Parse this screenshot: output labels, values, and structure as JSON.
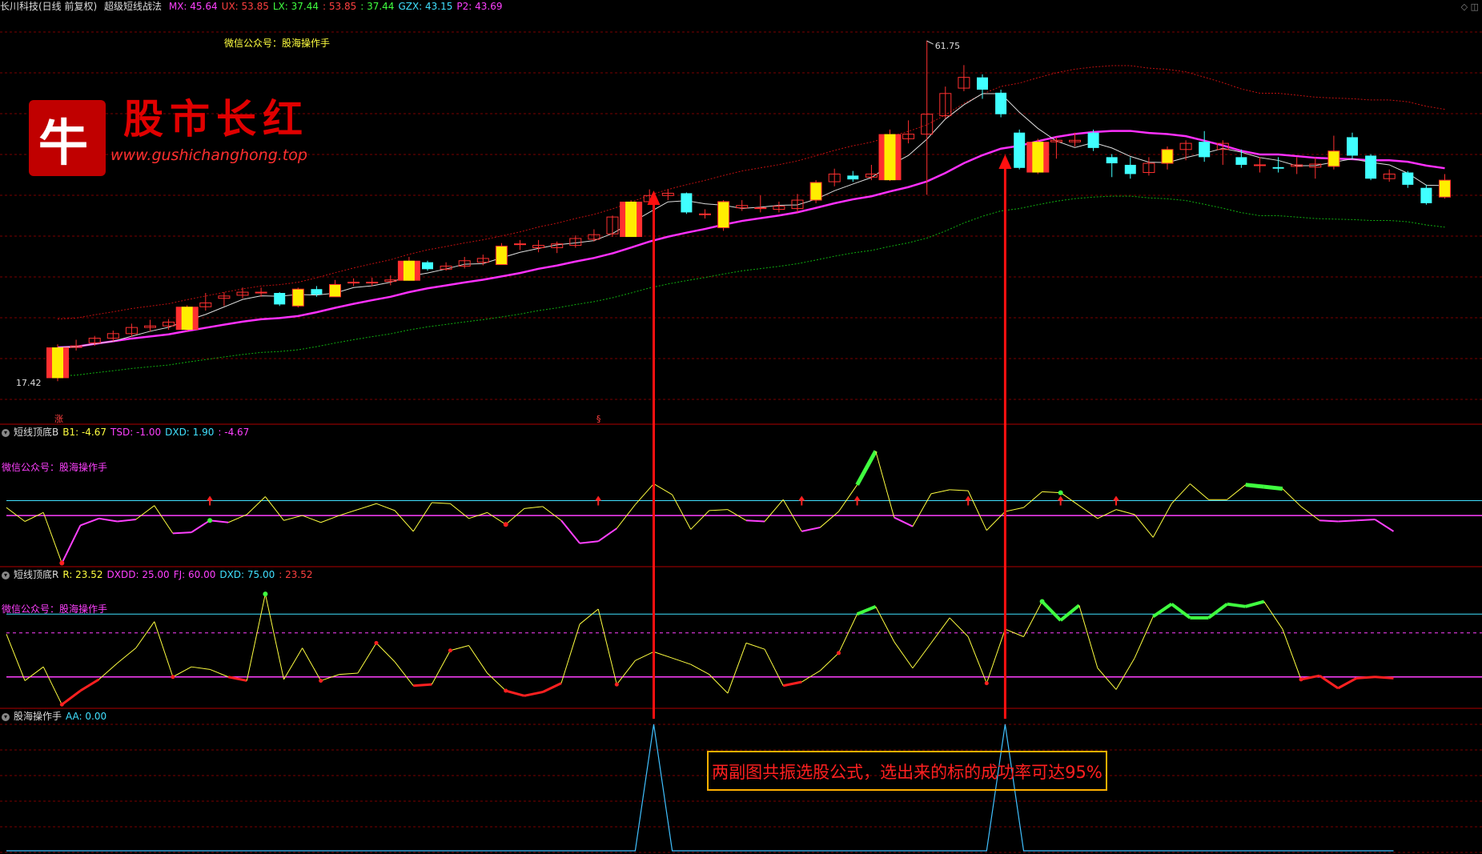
{
  "header": {
    "stock_title": "长川科技(日线 前复权)",
    "indicator_name": "超级短线战法",
    "values": [
      {
        "text": "MX: 45.64",
        "color": "#ff40ff"
      },
      {
        "text": "UX: 53.85",
        "color": "#ff4040"
      },
      {
        "text": "LX: 37.44",
        "color": "#40ff40"
      },
      {
        "text": ": 53.85",
        "color": "#ff4040"
      },
      {
        "text": ": 37.44",
        "color": "#40ff40"
      },
      {
        "text": "GZX: 43.15",
        "color": "#40e0ff"
      },
      {
        "text": "P2: 43.69",
        "color": "#ff40ff"
      }
    ],
    "wechat": "微信公众号：股海操作手"
  },
  "logo": {
    "char": "牛",
    "name": "股市长红",
    "url": "www.gushichanghong.top"
  },
  "top_right_icons": "◇ ◫",
  "main_chart": {
    "high_label": "61.75",
    "low_label": "17.42",
    "up_marker": "涨",
    "s_marker": "§"
  },
  "panel1": {
    "title": "短线顶底B",
    "values": [
      {
        "text": "B1: -4.67",
        "color": "#ffff40"
      },
      {
        "text": "TSD: -1.00",
        "color": "#ff40ff"
      },
      {
        "text": "DXD: 1.90",
        "color": "#40e0ff"
      },
      {
        "text": ": -4.67",
        "color": "#ff40ff"
      }
    ],
    "wechat": "微信公众号：股海操作手"
  },
  "panel2": {
    "title": "短线顶底R",
    "values": [
      {
        "text": "R: 23.52",
        "color": "#ffff40"
      },
      {
        "text": "DXDD: 25.00",
        "color": "#ff40ff"
      },
      {
        "text": "FJ: 60.00",
        "color": "#ff40ff"
      },
      {
        "text": "DXD: 75.00",
        "color": "#40e0ff"
      },
      {
        "text": ": 23.52",
        "color": "#ff4040"
      }
    ],
    "wechat": "微信公众号：股海操作手"
  },
  "panel3": {
    "title": "股海操作手",
    "values": [
      {
        "text": "AA: 0.00",
        "color": "#40e0ff"
      }
    ]
  },
  "annotation": "两副图共振选股公式，选出来的标的成功率可达95%",
  "colors": {
    "up": "#ff3030",
    "down": "#40ffff",
    "big_up_fill": "#ffee00",
    "ma_white": "#dddddd",
    "ma_magenta": "#ff30ff",
    "band_red": "#c01010",
    "band_green": "#10b010",
    "grid": "#7a0000",
    "arrow": "#ff1010"
  },
  "chart_data": [
    {
      "type": "candlestick",
      "title": "超级短线战法",
      "count": 76,
      "candles": [
        {
          "o": 17.8,
          "c": 21.8,
          "h": 22.2,
          "l": 17.4,
          "big": true
        },
        {
          "o": 21.8,
          "c": 22.0,
          "h": 22.8,
          "l": 21.4
        },
        {
          "o": 22.4,
          "c": 23.0,
          "h": 23.3,
          "l": 22.0
        },
        {
          "o": 23.0,
          "c": 23.6,
          "h": 24.0,
          "l": 22.6
        },
        {
          "o": 23.6,
          "c": 24.4,
          "h": 24.9,
          "l": 23.2
        },
        {
          "o": 24.4,
          "c": 24.6,
          "h": 25.4,
          "l": 23.9
        },
        {
          "o": 24.6,
          "c": 25.1,
          "h": 25.5,
          "l": 24.1
        },
        {
          "o": 24.1,
          "c": 27.1,
          "h": 27.3,
          "l": 23.9,
          "big": true
        },
        {
          "o": 27.1,
          "c": 27.6,
          "h": 28.9,
          "l": 26.6
        },
        {
          "o": 28.2,
          "c": 28.5,
          "h": 29.0,
          "l": 27.2
        },
        {
          "o": 28.6,
          "c": 29.0,
          "h": 29.6,
          "l": 28.2
        },
        {
          "o": 28.9,
          "c": 29.0,
          "h": 29.6,
          "l": 28.4
        },
        {
          "o": 28.9,
          "c": 27.4,
          "h": 29.0,
          "l": 27.2,
          "bear": true
        },
        {
          "o": 27.2,
          "c": 29.4,
          "h": 29.6,
          "l": 27.0,
          "fill": true
        },
        {
          "o": 29.4,
          "c": 28.7,
          "h": 29.8,
          "l": 28.4,
          "bear": true
        },
        {
          "o": 28.4,
          "c": 30.0,
          "h": 30.6,
          "l": 28.4,
          "fill": true
        },
        {
          "o": 30.2,
          "c": 30.3,
          "h": 30.8,
          "l": 29.8
        },
        {
          "o": 30.2,
          "c": 30.3,
          "h": 30.9,
          "l": 29.8
        },
        {
          "o": 30.4,
          "c": 30.6,
          "h": 31.2,
          "l": 29.9
        },
        {
          "o": 30.5,
          "c": 33.1,
          "h": 33.6,
          "l": 30.5,
          "big": true
        },
        {
          "o": 32.9,
          "c": 32.0,
          "h": 33.1,
          "l": 31.8,
          "bear": true
        },
        {
          "o": 32.0,
          "c": 32.4,
          "h": 32.9,
          "l": 31.8
        },
        {
          "o": 32.4,
          "c": 33.1,
          "h": 33.6,
          "l": 32.1
        },
        {
          "o": 32.9,
          "c": 33.4,
          "h": 33.9,
          "l": 32.5
        },
        {
          "o": 32.6,
          "c": 35.0,
          "h": 35.4,
          "l": 32.6,
          "fill": true
        },
        {
          "o": 35.2,
          "c": 35.3,
          "h": 35.8,
          "l": 34.5
        },
        {
          "o": 34.8,
          "c": 35.1,
          "h": 35.8,
          "l": 34.2
        },
        {
          "o": 34.8,
          "c": 35.3,
          "h": 35.6,
          "l": 34.1
        },
        {
          "o": 35.1,
          "c": 36.0,
          "h": 36.4,
          "l": 34.8
        },
        {
          "o": 35.9,
          "c": 36.5,
          "h": 37.2,
          "l": 35.6
        },
        {
          "o": 36.6,
          "c": 38.8,
          "h": 39.0,
          "l": 36.2
        },
        {
          "o": 36.2,
          "c": 40.8,
          "h": 41.0,
          "l": 36.2,
          "big": true
        },
        {
          "o": 40.8,
          "c": 41.6,
          "h": 42.4,
          "l": 40.4
        },
        {
          "o": 41.6,
          "c": 41.9,
          "h": 42.4,
          "l": 41.0
        },
        {
          "o": 41.9,
          "c": 39.4,
          "h": 42.0,
          "l": 39.2,
          "bear": true
        },
        {
          "o": 39.2,
          "c": 39.2,
          "h": 39.8,
          "l": 38.6
        },
        {
          "o": 37.4,
          "c": 40.8,
          "h": 41.0,
          "l": 37.0,
          "fill": true
        },
        {
          "o": 40.0,
          "c": 40.3,
          "h": 41.0,
          "l": 39.6
        },
        {
          "o": 39.9,
          "c": 40.0,
          "h": 41.6,
          "l": 39.4
        },
        {
          "o": 39.8,
          "c": 40.2,
          "h": 40.8,
          "l": 39.4
        },
        {
          "o": 39.9,
          "c": 41.0,
          "h": 41.8,
          "l": 39.4
        },
        {
          "o": 41.0,
          "c": 43.3,
          "h": 43.6,
          "l": 40.6,
          "fill": true
        },
        {
          "o": 43.4,
          "c": 44.4,
          "h": 45.1,
          "l": 42.8
        },
        {
          "o": 44.2,
          "c": 43.7,
          "h": 44.8,
          "l": 43.4,
          "bear": true
        },
        {
          "o": 44.0,
          "c": 44.4,
          "h": 45.6,
          "l": 43.6
        },
        {
          "o": 43.6,
          "c": 49.6,
          "h": 50.2,
          "l": 43.5,
          "big": true
        },
        {
          "o": 49.0,
          "c": 49.6,
          "h": 51.4,
          "l": 48.4
        },
        {
          "o": 49.6,
          "c": 52.2,
          "h": 61.8,
          "l": 41.7
        },
        {
          "o": 52.0,
          "c": 54.9,
          "h": 55.8,
          "l": 51.6
        },
        {
          "o": 55.6,
          "c": 57.0,
          "h": 58.6,
          "l": 55.2
        },
        {
          "o": 57.0,
          "c": 55.4,
          "h": 57.4,
          "l": 54.2,
          "bear": true
        },
        {
          "o": 55.0,
          "c": 52.2,
          "h": 55.4,
          "l": 51.8,
          "bear": true
        },
        {
          "o": 49.8,
          "c": 45.2,
          "h": 50.2,
          "l": 45.0,
          "bear": true
        },
        {
          "o": 44.6,
          "c": 48.6,
          "h": 49.0,
          "l": 44.4,
          "big": true
        },
        {
          "o": 48.6,
          "c": 48.8,
          "h": 49.2,
          "l": 46.4
        },
        {
          "o": 48.6,
          "c": 48.8,
          "h": 49.8,
          "l": 48.0
        },
        {
          "o": 49.8,
          "c": 47.8,
          "h": 50.2,
          "l": 47.4,
          "bear": true
        },
        {
          "o": 46.6,
          "c": 45.8,
          "h": 47.0,
          "l": 44.0,
          "bear": true
        },
        {
          "o": 45.6,
          "c": 44.4,
          "h": 46.6,
          "l": 43.8,
          "bear": true
        },
        {
          "o": 44.6,
          "c": 45.8,
          "h": 46.6,
          "l": 44.2
        },
        {
          "o": 45.8,
          "c": 47.6,
          "h": 48.0,
          "l": 45.0,
          "fill": true
        },
        {
          "o": 47.6,
          "c": 48.4,
          "h": 48.8,
          "l": 46.2
        },
        {
          "o": 48.6,
          "c": 46.6,
          "h": 50.0,
          "l": 46.0,
          "bear": true
        },
        {
          "o": 47.6,
          "c": 48.4,
          "h": 48.8,
          "l": 45.6
        },
        {
          "o": 46.6,
          "c": 45.6,
          "h": 47.6,
          "l": 45.2,
          "bear": true
        },
        {
          "o": 45.6,
          "c": 45.6,
          "h": 46.6,
          "l": 44.6
        },
        {
          "o": 45.3,
          "c": 45.1,
          "h": 46.6,
          "l": 44.6,
          "bear": true
        },
        {
          "o": 45.4,
          "c": 45.6,
          "h": 46.6,
          "l": 44.4
        },
        {
          "o": 45.3,
          "c": 45.7,
          "h": 46.6,
          "l": 43.8
        },
        {
          "o": 45.4,
          "c": 47.4,
          "h": 49.4,
          "l": 45.0,
          "fill": true
        },
        {
          "o": 49.2,
          "c": 46.8,
          "h": 49.8,
          "l": 46.4,
          "bear": true
        },
        {
          "o": 46.8,
          "c": 43.8,
          "h": 47.0,
          "l": 43.6,
          "bear": true
        },
        {
          "o": 43.8,
          "c": 44.4,
          "h": 45.0,
          "l": 43.4
        },
        {
          "o": 44.6,
          "c": 43.0,
          "h": 44.8,
          "l": 42.6,
          "bear": true
        },
        {
          "o": 42.6,
          "c": 40.6,
          "h": 43.0,
          "l": 40.4,
          "bear": true
        },
        {
          "o": 41.4,
          "c": 43.6,
          "h": 44.4,
          "l": 41.2,
          "fill": true
        }
      ]
    },
    {
      "type": "line",
      "title": "短线顶底B",
      "series": [
        {
          "name": "B1",
          "values": [
            0.8,
            -0.6,
            0.3,
            -4.8,
            -1.0,
            -0.3,
            -0.6,
            -0.4,
            1.0,
            -1.8,
            -1.7,
            -0.5,
            -0.7,
            0.1,
            1.9,
            -0.5,
            0.0,
            -0.7,
            0.0,
            0.6,
            1.2,
            0.5,
            -1.6,
            1.3,
            1.2,
            -0.3,
            0.3,
            -0.9,
            0.7,
            0.9,
            -0.5,
            -2.8,
            -2.6,
            -1.3,
            1.1,
            3.2,
            2.1,
            -1.4,
            0.5,
            0.6,
            -0.5,
            -0.6,
            1.6,
            -1.6,
            -1.2,
            0.4,
            3.1,
            6.5,
            -0.2,
            -1.1,
            2.2,
            2.6,
            2.5,
            -1.5,
            0.4,
            0.8,
            2.4,
            2.3,
            1.0,
            -0.3,
            0.6,
            0.1,
            -2.2,
            1.2,
            3.2,
            1.6,
            1.6,
            3.1,
            2.9,
            2.7,
            0.9,
            -0.5,
            -0.6,
            -0.5,
            -0.4,
            -1.6
          ]
        },
        {
          "name": "TSD",
          "values": [
            0,
            0,
            0,
            0,
            0,
            0,
            0,
            0,
            0,
            0,
            0,
            0,
            0,
            0,
            0,
            0,
            0,
            0,
            0,
            0,
            0,
            0,
            0,
            0,
            0,
            0,
            0,
            0,
            0,
            0,
            0,
            0,
            0,
            0,
            0,
            0,
            0,
            0,
            0,
            0,
            0,
            0,
            0,
            0,
            0,
            0,
            0,
            0,
            0,
            0,
            0,
            0,
            0,
            0,
            0,
            0,
            0,
            0,
            0,
            0,
            0,
            0,
            0,
            0,
            0,
            0,
            0,
            0,
            0,
            0,
            0,
            0,
            0,
            0,
            0,
            0
          ]
        }
      ],
      "ylim": [
        -5,
        8
      ],
      "ref_lines": [
        1.5,
        0
      ]
    },
    {
      "type": "line",
      "title": "短线顶底R",
      "series": [
        {
          "name": "R",
          "values": [
            59,
            22,
            33,
            3,
            14,
            23,
            36,
            48,
            69,
            25,
            33,
            31,
            25,
            22,
            91,
            23,
            48,
            22,
            27,
            28,
            52,
            37,
            18,
            19,
            46,
            50,
            28,
            14,
            10,
            13,
            20,
            67,
            79,
            19,
            38,
            45,
            40,
            35,
            27,
            12,
            52,
            47,
            18,
            21,
            30,
            44,
            75,
            81,
            53,
            32,
            52,
            72,
            57,
            20,
            63,
            57,
            85,
            70,
            82,
            32,
            15,
            40,
            73,
            83,
            72,
            72,
            83,
            81,
            85,
            63,
            23,
            26,
            16,
            24,
            25,
            24
          ]
        }
      ],
      "ylim": [
        0,
        100
      ],
      "ref_lines": [
        75,
        60,
        25
      ]
    },
    {
      "type": "line",
      "title": "股海操作手",
      "series": [
        {
          "name": "AA",
          "values": [
            0,
            0,
            0,
            0,
            0,
            0,
            0,
            0,
            0,
            0,
            0,
            0,
            0,
            0,
            0,
            0,
            0,
            0,
            0,
            0,
            0,
            0,
            0,
            0,
            0,
            0,
            0,
            0,
            0,
            0,
            0,
            0,
            0,
            0,
            0,
            1,
            0,
            0,
            0,
            0,
            0,
            0,
            0,
            0,
            0,
            0,
            0,
            0,
            0,
            0,
            0,
            0,
            0,
            0,
            1,
            0,
            0,
            0,
            0,
            0,
            0,
            0,
            0,
            0,
            0,
            0,
            0,
            0,
            0,
            0,
            0,
            0,
            0,
            0,
            0,
            0
          ]
        }
      ],
      "ylim": [
        0,
        1
      ]
    }
  ]
}
